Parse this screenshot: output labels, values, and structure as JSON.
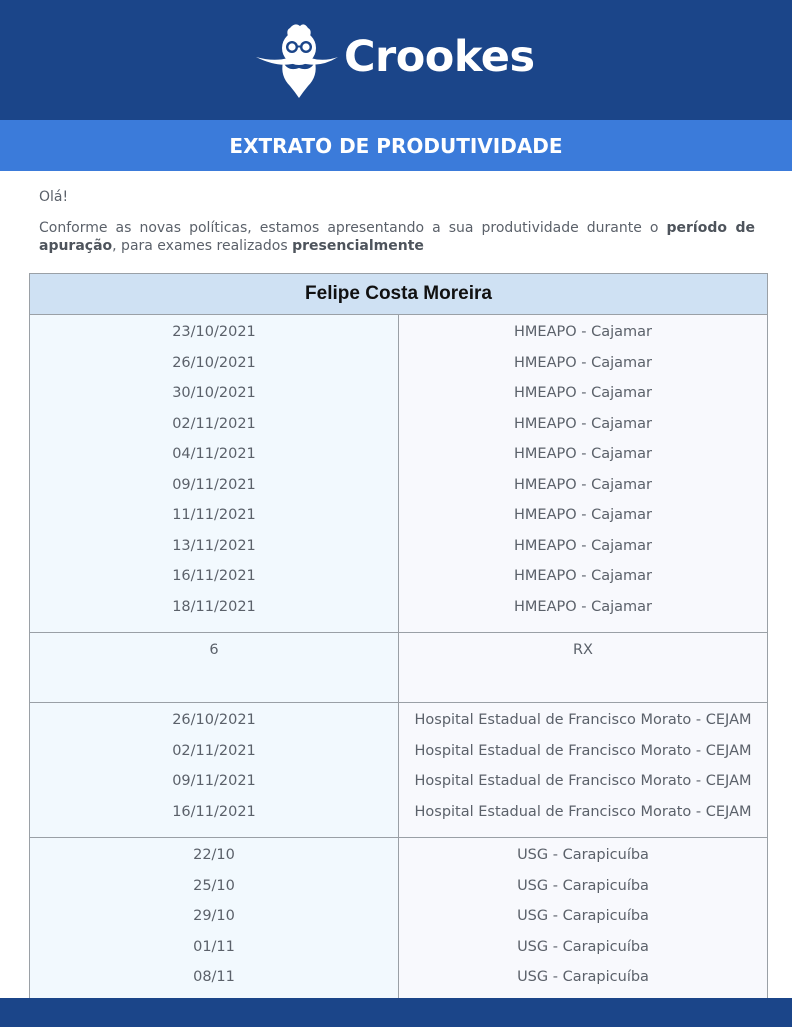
{
  "brand": {
    "name": "Crookes",
    "logo_icon": "bearded-man-glasses-icon"
  },
  "title_band": "EXTRATO DE PRODUTIVIDADE",
  "greeting": "Olá!",
  "intro": {
    "part1": "Conforme as novas políticas, estamos apresentando a sua produtividade durante o ",
    "bold1": "período de apuração",
    "part2": ", para exames realizados ",
    "bold2": "presencialmente"
  },
  "table": {
    "header": "Felipe Costa Moreira",
    "groups": [
      {
        "dates": [
          "23/10/2021",
          "26/10/2021",
          "30/10/2021",
          "02/11/2021",
          "04/11/2021",
          "09/11/2021",
          "11/11/2021",
          "13/11/2021",
          "16/11/2021",
          "18/11/2021"
        ],
        "locations": [
          "HMEAPO - Cajamar",
          "HMEAPO - Cajamar",
          "HMEAPO - Cajamar",
          "HMEAPO - Cajamar",
          "HMEAPO - Cajamar",
          "HMEAPO - Cajamar",
          "HMEAPO - Cajamar",
          "HMEAPO - Cajamar",
          "HMEAPO - Cajamar",
          "HMEAPO - Cajamar"
        ]
      },
      {
        "dates": [
          "6"
        ],
        "locations": [
          "RX"
        ],
        "tall": true
      },
      {
        "dates": [
          "26/10/2021",
          "02/11/2021",
          "09/11/2021",
          "16/11/2021"
        ],
        "locations": [
          "Hospital Estadual de Francisco Morato - CEJAM",
          "Hospital Estadual de Francisco Morato - CEJAM",
          "Hospital Estadual de Francisco Morato - CEJAM",
          "Hospital Estadual de Francisco Morato - CEJAM"
        ]
      },
      {
        "dates": [
          "22/10",
          "25/10",
          "29/10",
          "01/11",
          "08/11"
        ],
        "locations": [
          "USG - Carapicuíba",
          "USG - Carapicuíba",
          "USG - Carapicuíba",
          "USG - Carapicuíba",
          "USG - Carapicuíba"
        ]
      }
    ]
  },
  "colors": {
    "header_bg": "#1b4589",
    "title_band_bg": "#3b7bda",
    "table_header_bg": "#cfe1f3"
  }
}
